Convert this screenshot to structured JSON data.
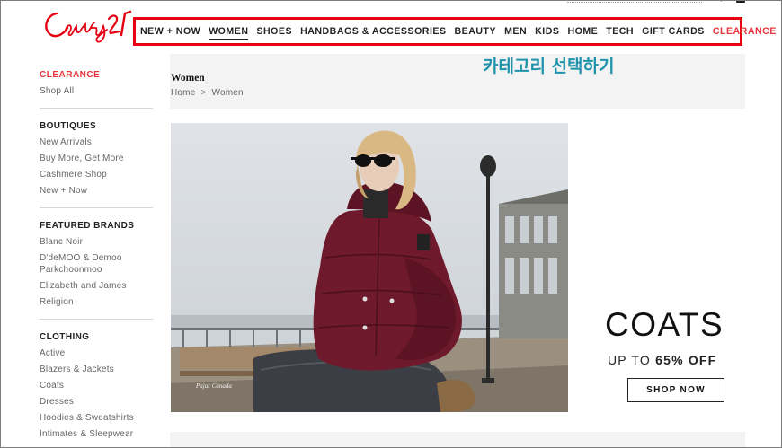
{
  "header": {
    "logo_text": "Century 21",
    "nav": [
      {
        "label": "NEW + NOW"
      },
      {
        "label": "WOMEN"
      },
      {
        "label": "SHOES"
      },
      {
        "label": "HANDBAGS & ACCESSORIES"
      },
      {
        "label": "BEAUTY"
      },
      {
        "label": "MEN"
      },
      {
        "label": "KIDS"
      },
      {
        "label": "HOME"
      },
      {
        "label": "TECH"
      },
      {
        "label": "GIFT CARDS"
      },
      {
        "label": "CLEARANCE"
      }
    ],
    "active_nav": "WOMEN"
  },
  "annotation": "카테고리 선택하기",
  "sidebar": {
    "clearance": "CLEARANCE",
    "shop_all": "Shop All",
    "sections": [
      {
        "title": "BOUTIQUES",
        "items": [
          "New Arrivals",
          "Buy More, Get More",
          "Cashmere Shop",
          "New + Now"
        ]
      },
      {
        "title": "FEATURED BRANDS",
        "items": [
          "Blanc Noir",
          "D'deMOO & Demoo Parkchoonmoo",
          "Elizabeth and James",
          "Religion"
        ]
      },
      {
        "title": "CLOTHING",
        "items": [
          "Active",
          "Blazers & Jackets",
          "Coats",
          "Dresses",
          "Hoodies & Sweatshirts",
          "Intimates & Sleepwear"
        ]
      }
    ]
  },
  "main": {
    "title": "Women",
    "breadcrumb": [
      "Home",
      "Women"
    ],
    "breadcrumb_sep": ">",
    "banner": {
      "photo_caption": "Pajar Canada",
      "headline": "COATS",
      "subline_prefix": "UP TO ",
      "subline_strong": "65% OFF",
      "cta": "SHOP NOW"
    }
  },
  "colors": {
    "accent_red": "#e8343b",
    "annotation_box": "#e60012",
    "annotation_text": "#1f93ab",
    "jacket": "#6e1a2c"
  }
}
